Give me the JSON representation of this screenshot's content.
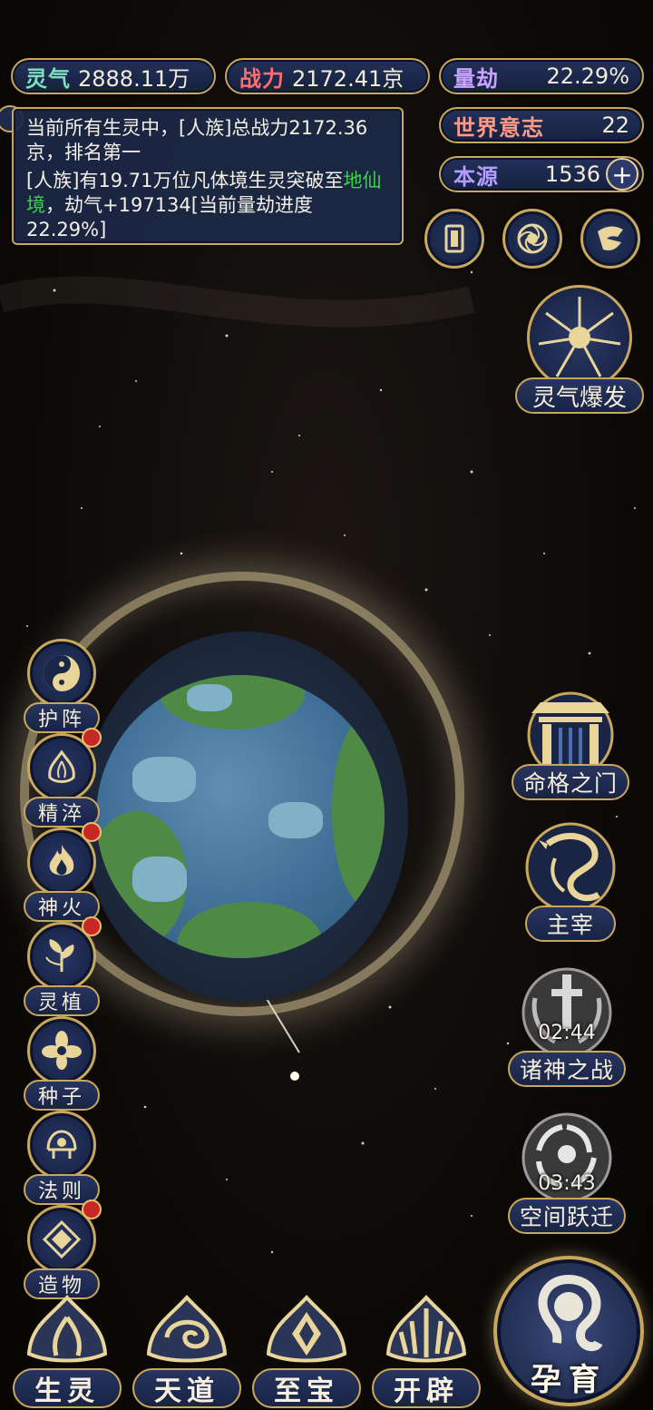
{
  "stats": {
    "lingqi": {
      "key": "灵气",
      "value": "2888.11万",
      "color": "#7ee0c0"
    },
    "zhanli": {
      "key": "战力",
      "value": "2172.41京",
      "color": "#ff6f6f"
    },
    "liangjie": {
      "key": "量劫",
      "value": "22.29%",
      "color": "#c9a4ff"
    },
    "shijie": {
      "key": "世界意志",
      "value": "22",
      "color": "#ff9a86"
    },
    "benyuan": {
      "key": "本源",
      "value": "1536",
      "color": "#b59cff"
    }
  },
  "message": {
    "line1": "当前所有生灵中，[人族]总战力2172.36京，排名第一",
    "line2_pre": "[人族]有19.71万位凡体境生灵突破至",
    "line2_hl": "地仙境",
    "line2_post": "，劫气+197134[当前量劫进度22.29%]"
  },
  "top_icons": [
    "card-icon",
    "vortex-icon",
    "wing-icon"
  ],
  "burst": {
    "label": "灵气爆发"
  },
  "left_menu": [
    {
      "label": "护阵",
      "icon": "taiji-icon",
      "dot": false
    },
    {
      "label": "精淬",
      "icon": "flame-lotus-icon",
      "dot": true
    },
    {
      "label": "神火",
      "icon": "fire-icon",
      "dot": true
    },
    {
      "label": "灵植",
      "icon": "plant-icon",
      "dot": true
    },
    {
      "label": "种子",
      "icon": "flower-icon",
      "dot": false
    },
    {
      "label": "法则",
      "icon": "rune-icon",
      "dot": false
    },
    {
      "label": "造物",
      "icon": "diamond-icon",
      "dot": true
    }
  ],
  "right_menu": {
    "mingge": {
      "label": "命格之门"
    },
    "zhuzai": {
      "label": "主宰"
    },
    "zhushen": {
      "label": "诸神之战",
      "timer": "02:44"
    },
    "kongjian": {
      "label": "空间跃迁",
      "timer": "03:43"
    }
  },
  "bottom_nav": [
    {
      "label": "生灵"
    },
    {
      "label": "天道"
    },
    {
      "label": "至宝"
    },
    {
      "label": "开辟"
    }
  ],
  "yunyu": {
    "label": "孕育"
  }
}
